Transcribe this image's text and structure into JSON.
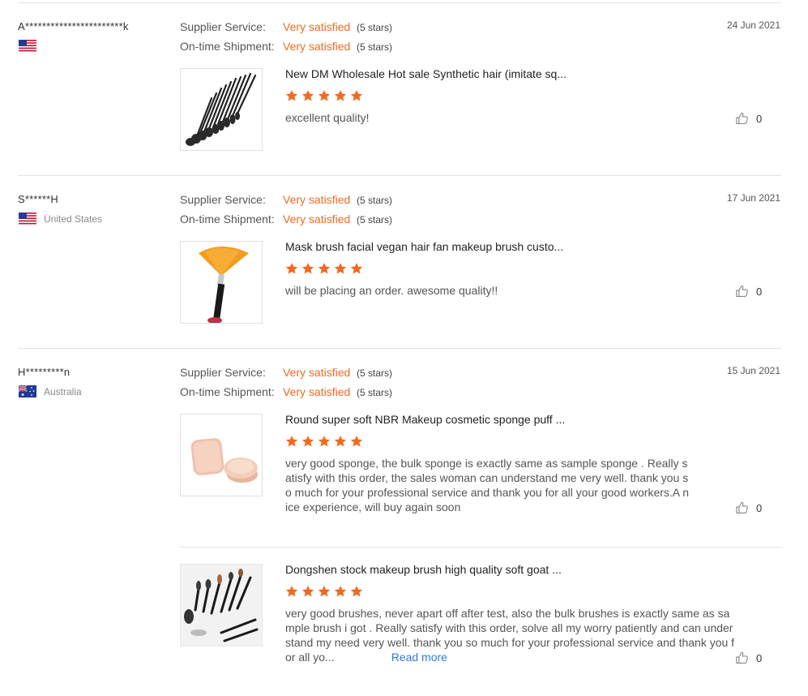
{
  "colors": {
    "accent": "#f26a21",
    "link": "#2a7ae2",
    "star": "#f26a21",
    "divider": "#e3e3e3"
  },
  "reviews": [
    {
      "buyer": "A***********************k",
      "country": "",
      "flag": "us-flag",
      "date": "24 Jun 2021",
      "supplier_label": "Supplier Service:",
      "supplier_value": "Very satisfied",
      "supplier_stars": "(5 stars)",
      "shipment_label": "On-time Shipment:",
      "shipment_value": "Very satisfied",
      "shipment_stars": "(5 stars)",
      "products": [
        {
          "title": "New DM Wholesale Hot sale Synthetic hair (imitate sq...",
          "rating": 5,
          "text": "excellent quality!",
          "likes": "0",
          "image": "makeup-brush-set-fan"
        }
      ]
    },
    {
      "buyer": "S******H",
      "country": "United States",
      "flag": "us-flag",
      "date": "17 Jun 2021",
      "supplier_label": "Supplier Service:",
      "supplier_value": "Very satisfied",
      "supplier_stars": "(5 stars)",
      "shipment_label": "On-time Shipment:",
      "shipment_value": "Very satisfied",
      "shipment_stars": "(5 stars)",
      "products": [
        {
          "title": "Mask brush facial vegan hair fan makeup brush custo...",
          "rating": 5,
          "text": "will be placing an order. awesome quality!!",
          "likes": "0",
          "image": "fan-mask-brush"
        }
      ]
    },
    {
      "buyer": "H*********n",
      "country": "Australia",
      "flag": "au-flag",
      "date": "15 Jun 2021",
      "supplier_label": "Supplier Service:",
      "supplier_value": "Very satisfied",
      "supplier_stars": "(5 stars)",
      "shipment_label": "On-time Shipment:",
      "shipment_value": "Very satisfied",
      "shipment_stars": "(5 stars)",
      "products": [
        {
          "title": "Round super soft NBR Makeup cosmetic sponge puff ...",
          "rating": 5,
          "text": "very good sponge,  the bulk sponge is exactly same as sample sponge . Really satisfy with this order,  the sales woman can understand me very well. thank you so much for your professional service and thank you for all your good workers.A nice experience, will buy again soon",
          "likes": "0",
          "image": "sponge-puffs"
        },
        {
          "title": "Dongshen stock makeup brush high quality soft goat ...",
          "rating": 5,
          "text": "very good brushes, never apart off after test, also the bulk brushes is exactly same as sample brush i got . Really satisfy with this order, solve all my worry patiently and can understand my need very well. thank you so much for your professional service and thank you for all yo...",
          "read_more": "Read more",
          "likes": "0",
          "image": "brush-set-scattered"
        }
      ]
    }
  ]
}
